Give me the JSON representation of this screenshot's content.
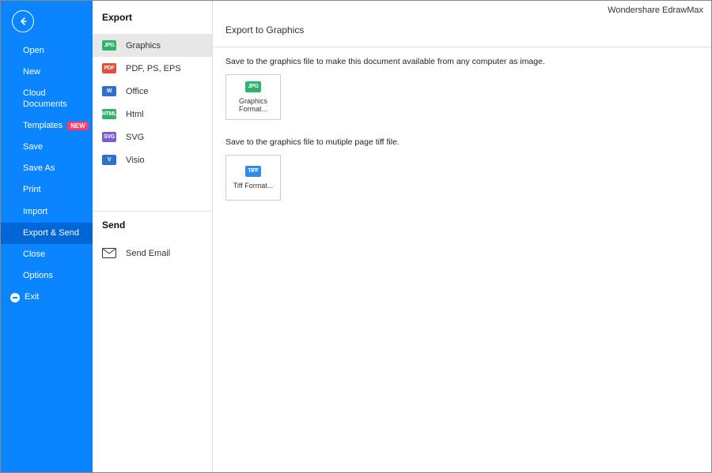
{
  "app_title": "Wondershare EdrawMax",
  "sidebar": {
    "items": [
      {
        "label": "Open"
      },
      {
        "label": "New"
      },
      {
        "label": "Cloud Documents"
      },
      {
        "label": "Templates",
        "badge": "NEW"
      },
      {
        "label": "Save"
      },
      {
        "label": "Save As"
      },
      {
        "label": "Print"
      },
      {
        "label": "Import"
      },
      {
        "label": "Export & Send"
      },
      {
        "label": "Close"
      },
      {
        "label": "Options"
      },
      {
        "label": "Exit"
      }
    ]
  },
  "mid": {
    "export_header": "Export",
    "send_header": "Send",
    "types": [
      {
        "label": "Graphics",
        "abbr": "JPG"
      },
      {
        "label": "PDF, PS, EPS",
        "abbr": "PDF"
      },
      {
        "label": "Office",
        "abbr": "W"
      },
      {
        "label": "Html",
        "abbr": "HTML"
      },
      {
        "label": "SVG",
        "abbr": "SVG"
      },
      {
        "label": "Visio",
        "abbr": "V"
      }
    ],
    "send_label": "Send Email"
  },
  "right": {
    "header": "Export to Graphics",
    "desc1": "Save to the graphics file to make this document available from any computer as image.",
    "tile1_label": "Graphics Format...",
    "tile1_abbr": "JPG",
    "desc2": "Save to the graphics file to mutiple page tiff file.",
    "tile2_label": "Tiff Format...",
    "tile2_abbr": "TIFF"
  }
}
